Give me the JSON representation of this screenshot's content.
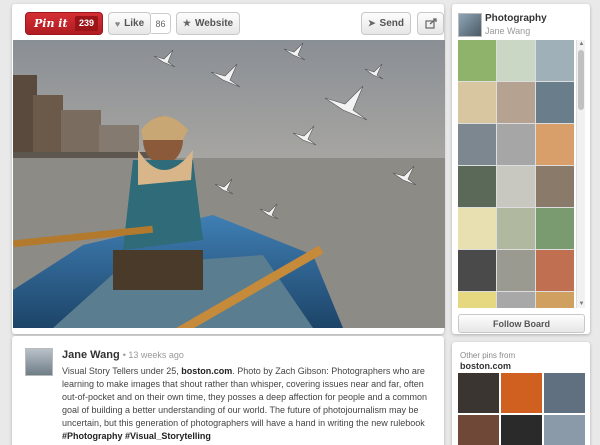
{
  "pin_actions": {
    "pin_it_label": "Pin it",
    "pin_count": "239",
    "like_label": "Like",
    "like_count": "86",
    "website_label": "Website",
    "send_label": "Send"
  },
  "description": {
    "author": "Jane Wang",
    "time": "• 13 weeks ago",
    "source": "boston.com",
    "text_before_source": "Visual Story Tellers under 25, ",
    "text_after_source": ". Photo by Zach Gibson: Photographers who are learning to make images that shout rather than whisper, covering issues near and far, often out-of-pocket and on their own time, they posses a deep affection for people and a common goal of building a better understanding of our world. The future of photojournalism may be uncertain, but this generation of photographers will have a hand in writing the new rulebook",
    "hashtags": "#Photography #Visual_Storytelling"
  },
  "board": {
    "title": "Photography",
    "owner": "Jane Wang",
    "follow_label": "Follow Board",
    "thumbnail_colors": [
      "#8fb36a",
      "#c9d7c4",
      "#9fb0b8",
      "#d8c6a0",
      "#b5a290",
      "#6a7d8a",
      "#7d8790",
      "#a6a6a6",
      "#d99f6a",
      "#5b6a58",
      "#c8c8c0",
      "#8a7a6a",
      "#e8e0b0",
      "#b0b8a0",
      "#7a9a70",
      "#4a4a4a",
      "#9a9a90",
      "#c07050",
      "#e6d880",
      "#a8a8a8",
      "#d0a060",
      "#e0c090",
      "#909898",
      "#d8c040"
    ]
  },
  "other_pins": {
    "label": "Other pins from",
    "source": "boston.com",
    "thumbnail_colors": [
      "#3a3530",
      "#d06020",
      "#607080",
      "#704838",
      "#2a2a2a",
      "#8a9aa8"
    ]
  }
}
